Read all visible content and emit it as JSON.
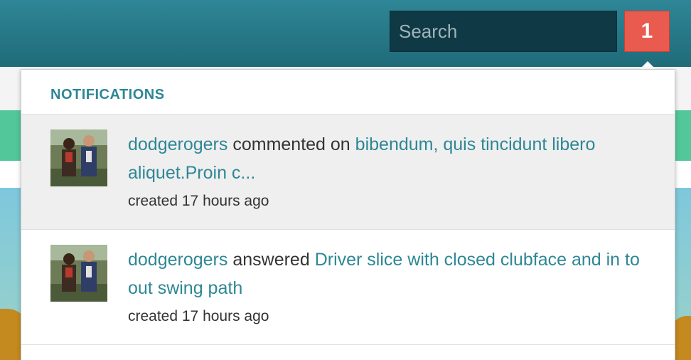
{
  "header": {
    "search": {
      "placeholder": "Search"
    },
    "notification_count": "1"
  },
  "notifications": {
    "title": "NOTIFICATIONS",
    "items": [
      {
        "user": "dodgerogers",
        "action": "commented on",
        "target": "bibendum, quis tincidunt libero aliquet.Proin c...",
        "time": "created 17 hours ago",
        "highlighted": true
      },
      {
        "user": "dodgerogers",
        "action": "answered",
        "target": "Driver slice with closed clubface and in to out swing path",
        "time": "created 17 hours ago",
        "highlighted": false
      }
    ]
  },
  "colors": {
    "header_bg": "#2a7d8c",
    "link": "#2e8795",
    "badge": "#e95a4f",
    "search_bg": "#0f3a45",
    "highlight_row": "#efefef"
  }
}
